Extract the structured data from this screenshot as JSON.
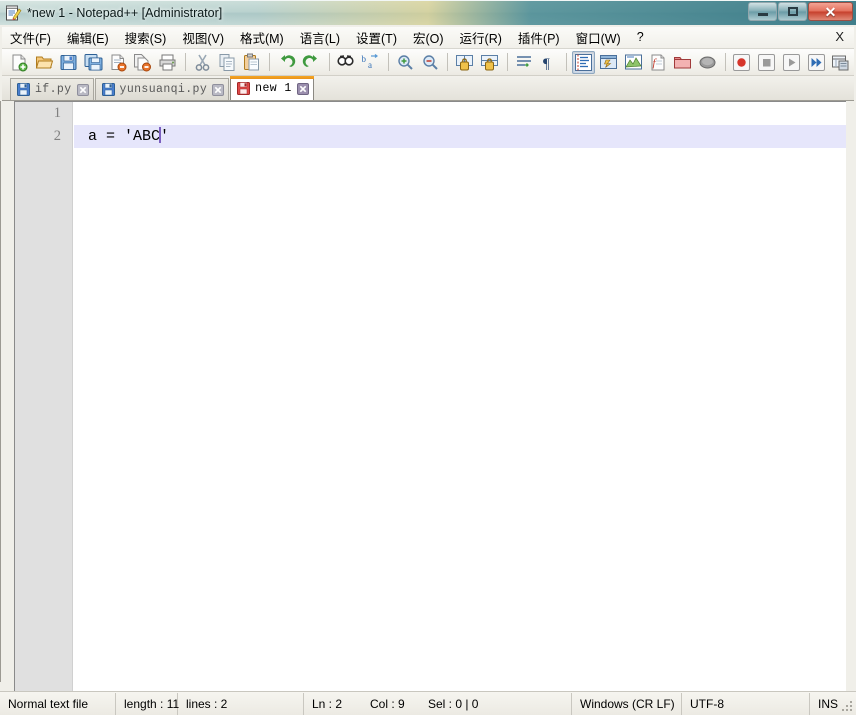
{
  "window": {
    "title": "*new 1 - Notepad++ [Administrator]",
    "icon": "notepad-plus-plus-icon",
    "controls": {
      "minimize": "–",
      "maximize": "□",
      "close": "✕"
    }
  },
  "menubar": {
    "items": [
      {
        "label": "文件(F)",
        "name": "menu-file"
      },
      {
        "label": "编辑(E)",
        "name": "menu-edit"
      },
      {
        "label": "搜索(S)",
        "name": "menu-search"
      },
      {
        "label": "视图(V)",
        "name": "menu-view"
      },
      {
        "label": "格式(M)",
        "name": "menu-format"
      },
      {
        "label": "语言(L)",
        "name": "menu-language"
      },
      {
        "label": "设置(T)",
        "name": "menu-settings"
      },
      {
        "label": "宏(O)",
        "name": "menu-macro"
      },
      {
        "label": "运行(R)",
        "name": "menu-run"
      },
      {
        "label": "插件(P)",
        "name": "menu-plugins"
      },
      {
        "label": "窗口(W)",
        "name": "menu-window"
      },
      {
        "label": "?",
        "name": "menu-help"
      }
    ],
    "close_document_label": "X"
  },
  "toolbar": {
    "buttons": [
      {
        "name": "new-file-icon",
        "tip": "New"
      },
      {
        "name": "open-file-icon",
        "tip": "Open"
      },
      {
        "name": "save-icon",
        "tip": "Save"
      },
      {
        "name": "save-all-icon",
        "tip": "Save All"
      },
      {
        "name": "close-file-icon",
        "tip": "Close"
      },
      {
        "name": "close-all-files-icon",
        "tip": "Close All"
      },
      {
        "name": "print-icon",
        "tip": "Print"
      },
      {
        "name": "separator-1",
        "tip": ""
      },
      {
        "name": "cut-icon",
        "tip": "Cut"
      },
      {
        "name": "copy-icon",
        "tip": "Copy"
      },
      {
        "name": "paste-icon",
        "tip": "Paste"
      },
      {
        "name": "separator-2",
        "tip": ""
      },
      {
        "name": "undo-icon",
        "tip": "Undo"
      },
      {
        "name": "redo-icon",
        "tip": "Redo"
      },
      {
        "name": "separator-3",
        "tip": ""
      },
      {
        "name": "find-icon",
        "tip": "Find"
      },
      {
        "name": "replace-icon",
        "tip": "Replace"
      },
      {
        "name": "separator-4",
        "tip": ""
      },
      {
        "name": "zoom-in-icon",
        "tip": "Zoom In"
      },
      {
        "name": "zoom-out-icon",
        "tip": "Zoom Out"
      },
      {
        "name": "separator-5",
        "tip": ""
      },
      {
        "name": "sync-vertical-scroll-icon",
        "tip": "Sync Vertical Scrolling"
      },
      {
        "name": "sync-horizontal-scroll-icon",
        "tip": "Sync Horizontal Scrolling"
      },
      {
        "name": "separator-6",
        "tip": ""
      },
      {
        "name": "word-wrap-icon",
        "tip": "Word Wrap"
      },
      {
        "name": "show-all-characters-icon",
        "tip": "Show All Characters"
      },
      {
        "name": "separator-7",
        "tip": ""
      },
      {
        "name": "indent-guideline-icon",
        "tip": "Show Indent Guide",
        "pressed": true
      },
      {
        "name": "user-defined-dialog-icon",
        "tip": "User Defined Dialogue"
      },
      {
        "name": "document-map-icon",
        "tip": "Document Map"
      },
      {
        "name": "function-list-icon",
        "tip": "Function List"
      },
      {
        "name": "folder-as-workspace-icon",
        "tip": "Folder as Workspace"
      },
      {
        "name": "monitoring-icon",
        "tip": "Monitoring"
      },
      {
        "name": "separator-8",
        "tip": ""
      },
      {
        "name": "record-macro-icon",
        "tip": "Start Recording"
      },
      {
        "name": "stop-recording-icon",
        "tip": "Stop Recording"
      },
      {
        "name": "play-macro-icon",
        "tip": "Playback"
      },
      {
        "name": "run-macro-multiple-icon",
        "tip": "Run a Macro Multiple Times"
      },
      {
        "name": "save-macro-icon",
        "tip": "Save Current Recorded Macro"
      }
    ]
  },
  "tabs": [
    {
      "label": "if.py",
      "active": false,
      "modified": false
    },
    {
      "label": "yunsuanqi.py",
      "active": false,
      "modified": false
    },
    {
      "label": "new 1",
      "active": true,
      "modified": true
    }
  ],
  "editor": {
    "line_numbers": [
      "1",
      "2"
    ],
    "lines": [
      {
        "text": "",
        "current": false
      },
      {
        "text_before_caret": "a = 'ABC",
        "text_after_caret": "'",
        "current": true
      }
    ],
    "caret_color": "#7b5fbf",
    "current_line_color": "#e6e6fb"
  },
  "statusbar": {
    "file_type": "Normal text file",
    "length": "length : 11",
    "lines": "lines : 2",
    "ln": "Ln : 2",
    "col": "Col : 9",
    "sel": "Sel : 0 | 0",
    "eol": "Windows (CR LF)",
    "encoding": "UTF-8",
    "insert_mode": "INS"
  },
  "colors": {
    "accent_tab": "#f5a623",
    "current_line": "#e6e6fb",
    "gutter": "#e0e0e0",
    "modified_tab_icon": "#e04a4a",
    "saved_tab_icon": "#4a7fd0"
  }
}
